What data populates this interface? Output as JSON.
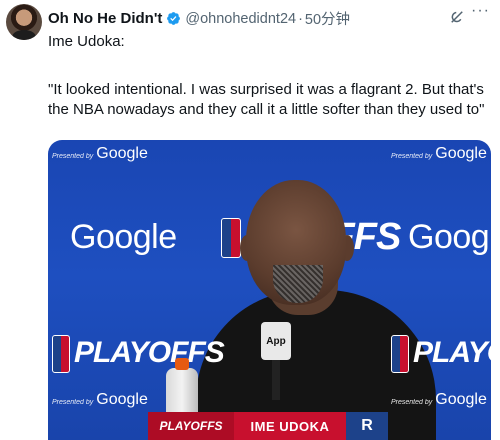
{
  "tweet": {
    "display_name": "Oh No He Didn't",
    "handle": "@ohnohedidnt24",
    "separator": "·",
    "time": "50分钟",
    "text_line1": "Ime Udoka:",
    "quote": "\"It looked intentional. I was surprised it was a flagrant 2. But that's the NBA nowadays and they call it a little softer than they used to\""
  },
  "icons": {
    "avatar": "profile-avatar",
    "verified": "verified-badge-icon",
    "grok": "grok-icon",
    "more": "more-icon"
  },
  "media": {
    "presented_by": "Presented by",
    "sponsor_small": "Google",
    "sponsor_large": "Google",
    "playoffs_text": "PLAYOFFS",
    "playoffs_partial": "OFFS",
    "mic_label": "App",
    "lower_third": {
      "left_text": "PLAYOFFS",
      "name": "IME UDOKA",
      "logo": "R"
    }
  },
  "colors": {
    "verified": "#1d9bf0",
    "backdrop": "#1e4fc0",
    "lower_third_red": "#c8102e",
    "lower_third_blue": "#1d428a"
  }
}
